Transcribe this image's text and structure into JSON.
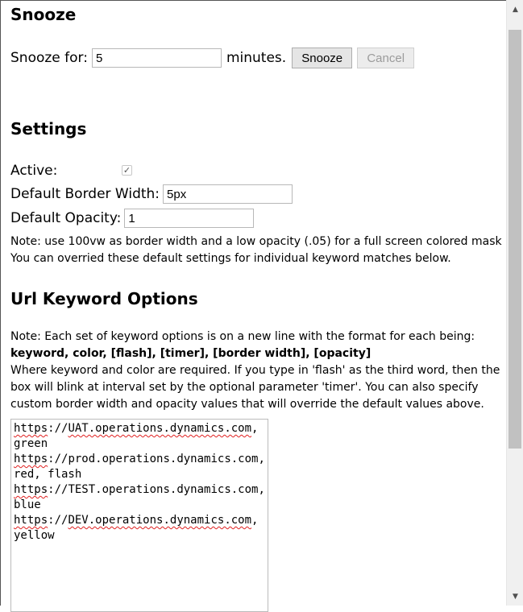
{
  "snooze": {
    "heading": "Snooze",
    "label": "Snooze for:",
    "value": "5",
    "unit": "minutes.",
    "snooze_button": "Snooze",
    "cancel_button": "Cancel"
  },
  "settings": {
    "heading": "Settings",
    "active_label": "Active:",
    "active_checked": true,
    "border_width_label": "Default Border Width:",
    "border_width_value": "5px",
    "opacity_label": "Default Opacity:",
    "opacity_value": "1",
    "note_line1": "Note: use 100vw as border width and a low opacity (.05) for a full screen colored mask",
    "note_line2": "You can overried these default settings for individual keyword matches below."
  },
  "url_options": {
    "heading": "Url Keyword Options",
    "note_line1": "Note: Each set of keyword options is on a new line with the format for each being:",
    "format": "keyword, color, [flash], [timer], [border width], [opacity]",
    "note_line3": "Where keyword and color are required. If you type in 'flash' as the third word, then the box will blink at interval set by the optional parameter 'timer'. You can also specify custom border width and opacity values that will override the default values above.",
    "entries": [
      {
        "prefix": "https",
        "rest": "://",
        "domain": "UAT.operations.dynamics.com",
        "tail": ", green"
      },
      {
        "prefix": "https",
        "rest": "://",
        "domain": "prod.operations.dynamics.com",
        "tail": ", red, flash"
      },
      {
        "prefix": "https",
        "rest": "://",
        "domain": "TEST.operations.dynamics.com",
        "tail": ", blue"
      },
      {
        "prefix": "https",
        "rest": "://",
        "domain": "DEV.operations.dynamics.com",
        "tail": ", yellow"
      }
    ]
  },
  "scrollbar": {
    "up_icon": "chevron-up-icon",
    "down_icon": "chevron-down-icon"
  }
}
